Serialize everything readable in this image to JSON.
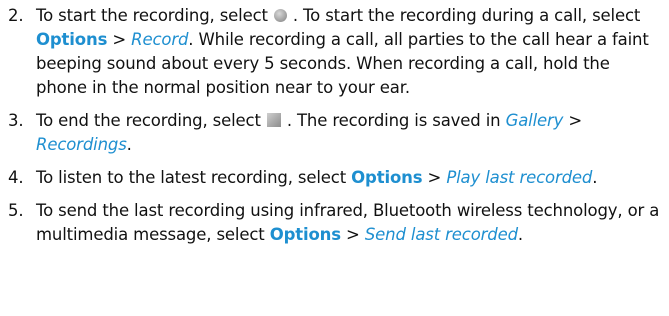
{
  "steps": [
    {
      "num": "2.",
      "t1": "To start the recording, select",
      "t2": ". To start the recording during a call, select",
      "opt": "Options",
      "sep": ">",
      "menu": "Record",
      "t3": ". While recording a call, all parties to the call hear a faint beeping sound about every 5 seconds. When recording a call, hold the phone in the normal position near to your ear.",
      "icon": "record-icon"
    },
    {
      "num": "3.",
      "t1": "To end the recording, select",
      "t2": ". The recording is saved in",
      "menu1": "Gallery",
      "sep": ">",
      "menu2": "Recordings",
      "t3": ".",
      "icon": "stop-icon"
    },
    {
      "num": "4.",
      "t1": "To listen to the latest recording, select",
      "opt": "Options",
      "sep": ">",
      "menu": "Play last recorded",
      "t2": "."
    },
    {
      "num": "5.",
      "t1": "To send the last recording using infrared, Bluetooth wireless technology, or a multimedia message, select",
      "opt": "Options",
      "sep": ">",
      "menu": "Send last recorded",
      "t2": "."
    }
  ],
  "colors": {
    "text": "#111111",
    "link": "#1e8fd0"
  }
}
